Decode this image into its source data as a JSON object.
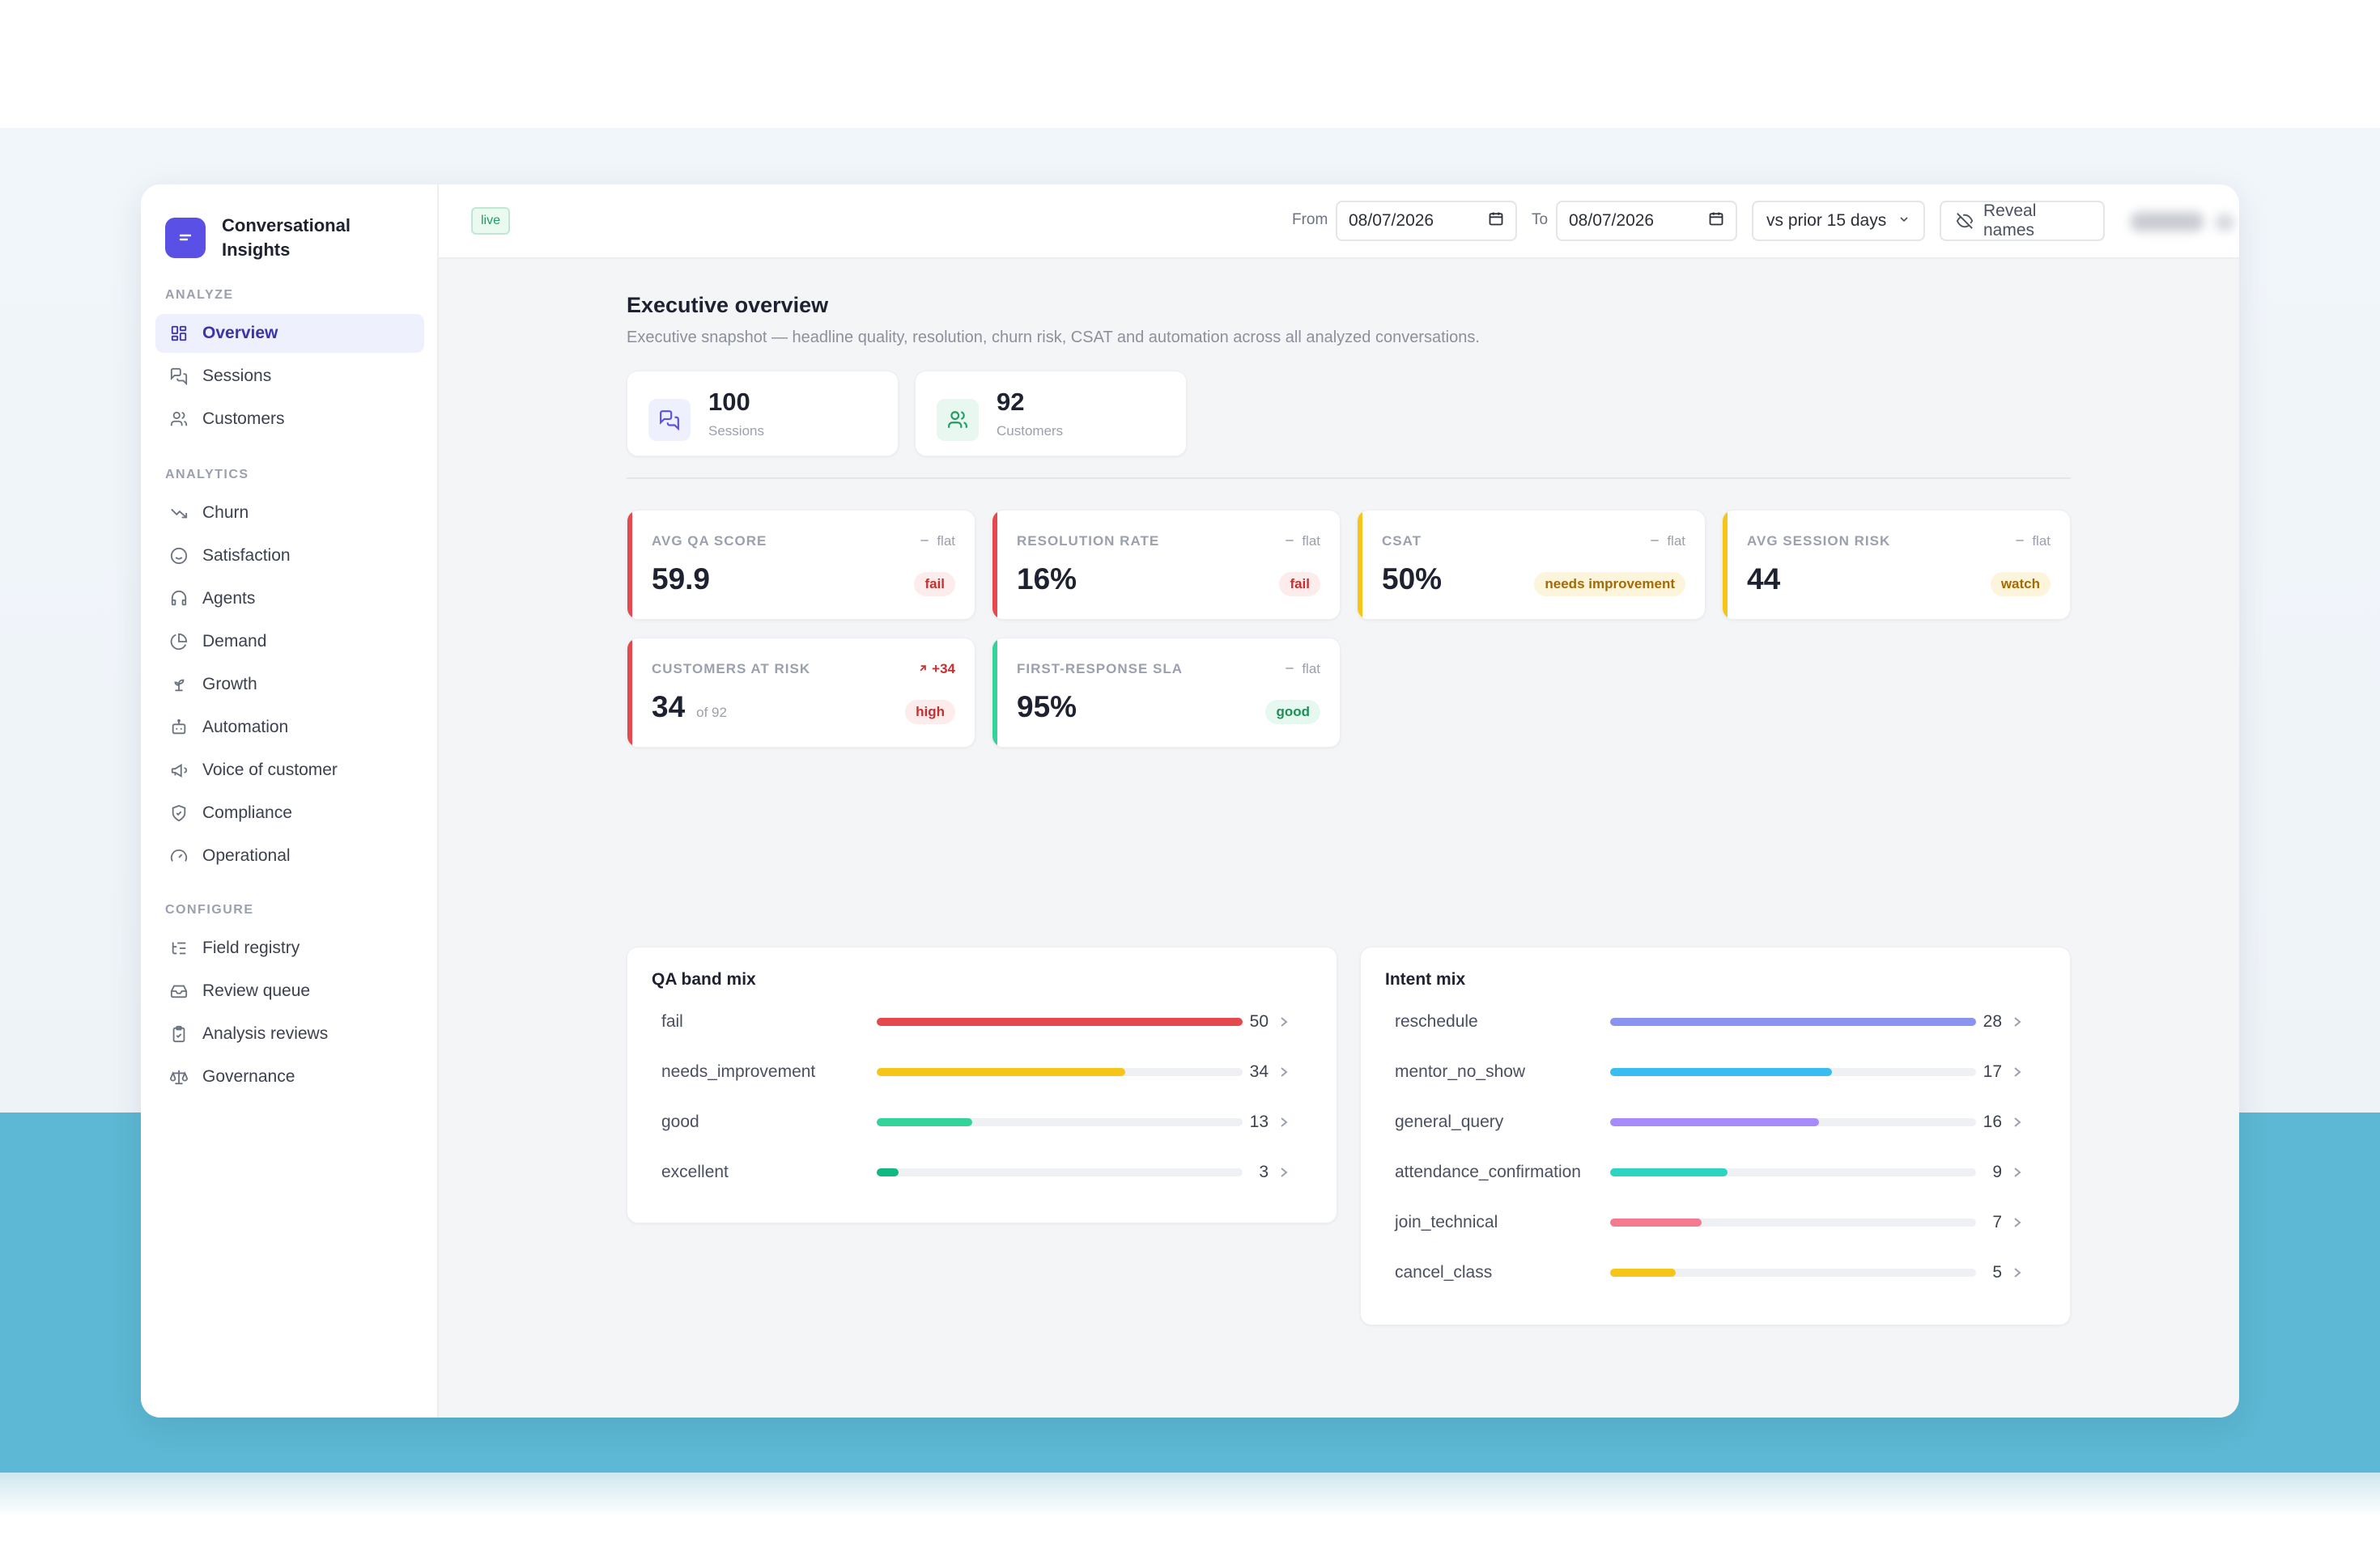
{
  "app": {
    "title": "Conversational Insights"
  },
  "sidebar": {
    "sections": [
      {
        "label": "ANALYZE",
        "items": [
          {
            "label": "Overview",
            "icon": "grid-icon",
            "active": true
          },
          {
            "label": "Sessions",
            "icon": "chat-icon"
          },
          {
            "label": "Customers",
            "icon": "users-icon"
          }
        ]
      },
      {
        "label": "ANALYTICS",
        "items": [
          {
            "label": "Churn",
            "icon": "trending-down-icon"
          },
          {
            "label": "Satisfaction",
            "icon": "smile-icon"
          },
          {
            "label": "Agents",
            "icon": "headset-icon"
          },
          {
            "label": "Demand",
            "icon": "pie-icon"
          },
          {
            "label": "Growth",
            "icon": "sprout-icon"
          },
          {
            "label": "Automation",
            "icon": "bot-icon"
          },
          {
            "label": "Voice of customer",
            "icon": "megaphone-icon"
          },
          {
            "label": "Compliance",
            "icon": "shield-icon"
          },
          {
            "label": "Operational",
            "icon": "gauge-icon"
          }
        ]
      },
      {
        "label": "CONFIGURE",
        "items": [
          {
            "label": "Field registry",
            "icon": "list-tree-icon"
          },
          {
            "label": "Review queue",
            "icon": "inbox-icon"
          },
          {
            "label": "Analysis reviews",
            "icon": "clipboard-check-icon"
          },
          {
            "label": "Governance",
            "icon": "scale-icon"
          }
        ]
      }
    ]
  },
  "topbar": {
    "live_badge": "live",
    "from_label": "From",
    "from_value": "08/07/2026",
    "to_label": "To",
    "to_value": "08/07/2026",
    "compare_value": "vs prior 15 days",
    "reveal_label": "Reveal names"
  },
  "page": {
    "title": "Executive overview",
    "subtitle": "Executive snapshot — headline quality, resolution, churn risk, CSAT and automation across all analyzed conversations."
  },
  "counts": [
    {
      "value": "100",
      "caption": "Sessions",
      "icon": "chat-icon",
      "color": "#5b50e6"
    },
    {
      "value": "92",
      "caption": "Customers",
      "icon": "users-icon",
      "color": "#1f9d62"
    }
  ],
  "kpis": [
    {
      "label": "AVG QA SCORE",
      "trend": "flat",
      "value": "59.9",
      "sub": "",
      "badge": "fail",
      "accent": "#e5484d",
      "badge_bg": "#fdecec",
      "badge_fg": "#c53030"
    },
    {
      "label": "RESOLUTION RATE",
      "trend": "flat",
      "value": "16%",
      "sub": "",
      "badge": "fail",
      "accent": "#e5484d",
      "badge_bg": "#fdecec",
      "badge_fg": "#c53030"
    },
    {
      "label": "CSAT",
      "trend": "flat",
      "value": "50%",
      "sub": "",
      "badge": "needs improvement",
      "accent": "#f5c518",
      "badge_bg": "#fdf4dc",
      "badge_fg": "#a36a06"
    },
    {
      "label": "AVG SESSION RISK",
      "trend": "flat",
      "value": "44",
      "sub": "",
      "badge": "watch",
      "accent": "#f5c518",
      "badge_bg": "#fdf4dc",
      "badge_fg": "#a36a06"
    },
    {
      "label": "CUSTOMERS AT RISK",
      "trend": "+34",
      "trend_up": true,
      "value": "34",
      "sub": "of 92",
      "badge": "high",
      "accent": "#e5484d",
      "badge_bg": "#fdecec",
      "badge_fg": "#c53030"
    },
    {
      "label": "FIRST-RESPONSE SLA",
      "trend": "flat",
      "value": "95%",
      "sub": "",
      "badge": "good",
      "accent": "#34d399",
      "badge_bg": "#e6f8ef",
      "badge_fg": "#1f8f57"
    }
  ],
  "qa_band_mix": {
    "title": "QA band mix",
    "max": 50,
    "rows": [
      {
        "label": "fail",
        "value": 50,
        "color": "#e5484d"
      },
      {
        "label": "needs_improvement",
        "value": 34,
        "color": "#f5c518"
      },
      {
        "label": "good",
        "value": 13,
        "color": "#34d399"
      },
      {
        "label": "excellent",
        "value": 3,
        "color": "#10b981"
      }
    ]
  },
  "intent_mix": {
    "title": "Intent mix",
    "max": 28,
    "rows": [
      {
        "label": "reschedule",
        "value": 28,
        "color": "#8b93f0"
      },
      {
        "label": "mentor_no_show",
        "value": 17,
        "color": "#38bdf0"
      },
      {
        "label": "general_query",
        "value": 16,
        "color": "#a78bfa"
      },
      {
        "label": "attendance_confirmation",
        "value": 9,
        "color": "#2dd4bf"
      },
      {
        "label": "join_technical",
        "value": 7,
        "color": "#f47a8f"
      },
      {
        "label": "cancel_class",
        "value": 5,
        "color": "#f5c518"
      }
    ]
  }
}
